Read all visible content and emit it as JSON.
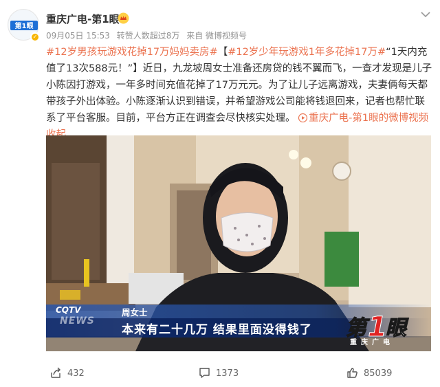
{
  "post": {
    "author": "重庆广电-第1眼",
    "date": "09月05日 15:53",
    "repost_info": "转赞人数超过8万",
    "source_label": "来自 微博视频号",
    "hashtag1": "#12岁男孩玩游戏花掉17万妈妈卖房#",
    "hashtag2": "#12岁少年玩游戏1年多花掉17万#",
    "quote": "“1天内充值了13次588元！”】",
    "body": "近日，九龙坡周女士准备还房贷的钱不翼而飞，一查才发现是儿子小陈因打游戏，一年多时间充值花掉了17万元元。为了让儿子远离游戏，夫妻俩每天都带孩子外出体验。小陈逐渐认识到错误，并希望游戏公司能将钱退回来，记者也帮忙联系了平台客服。目前，平台方正在调查会尽快核实处理。",
    "video_source": "重庆广电-第1眼的微博视频",
    "collapse_label": "收起",
    "avatar_text": "第1眼"
  },
  "video": {
    "speaker": "周女士",
    "caption": "本来有二十几万  结果里面没得钱了",
    "channel": "CQTV",
    "news": "NEWS",
    "watermark_sub": "重庆广电"
  },
  "actions": {
    "share_count": "432",
    "comment_count": "1373",
    "like_count": "85039"
  },
  "colors": {
    "link": "#eb7350",
    "meta": "#939393",
    "caption_bar": "#0a286e"
  },
  "icons": [
    "verified-icon",
    "vip-crown-icon",
    "chevron-down-icon",
    "video-play-icon",
    "share-icon",
    "comment-icon",
    "like-icon"
  ]
}
